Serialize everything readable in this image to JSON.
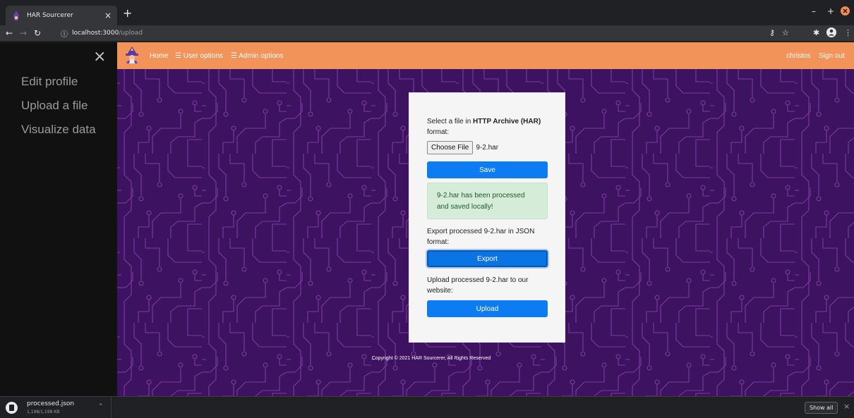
{
  "browser": {
    "tab_title": "HAR Sourcerer",
    "tab_close": "×",
    "new_tab": "+",
    "url_host": "localhost:3000",
    "url_path": "/upload",
    "minimize": "–",
    "maximize": "+",
    "close": "×"
  },
  "sidenav": {
    "close": "×",
    "items": [
      "Edit profile",
      "Upload a file",
      "Visualize data"
    ]
  },
  "navbar": {
    "home": "Home",
    "user_options": "☰ User options",
    "admin_options": "☰ Admin options",
    "username": "christos",
    "sign_out": "Sign out"
  },
  "upload_card": {
    "select_prefix": "Select a file in ",
    "select_bold": "HTTP Archive (HAR)",
    "select_suffix": " format:",
    "choose_file": "Choose File",
    "file_name": "9-2.har",
    "save": "Save",
    "success_message": "9-2.har has been processed and saved locally!",
    "export_text": "Export processed 9-2.har in JSON format:",
    "export": "Export",
    "upload_text": "Upload processed 9-2.har to our website:",
    "upload": "Upload"
  },
  "footer": "Copyright © 2021 HAR Sourcerer, All Rights Reserved",
  "download_shelf": {
    "file_name": "processed.json",
    "progress": "1,198/1,198 KB",
    "show_all": "Show all",
    "close": "×"
  },
  "colors": {
    "navbar": "#f2945a",
    "background": "#3d1260",
    "circuit_lines": "#7a3ca0",
    "primary_button": "#0d7cf2",
    "success_alert": "#d5ecd8"
  }
}
